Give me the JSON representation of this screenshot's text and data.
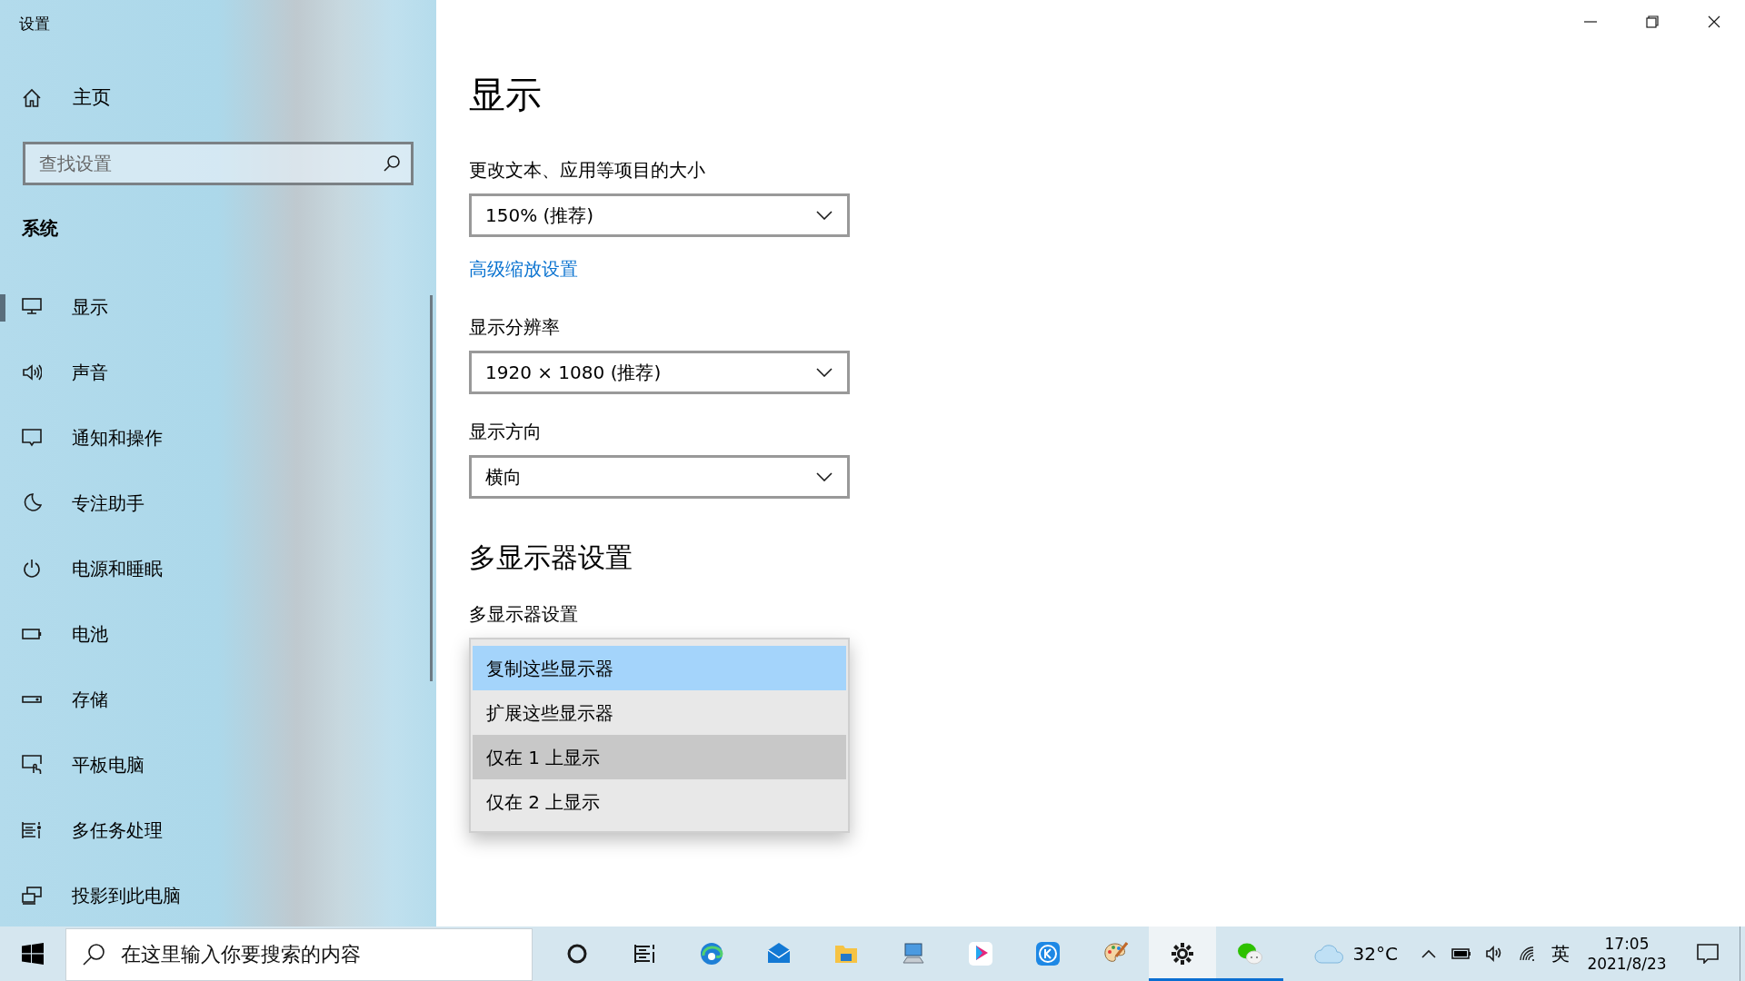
{
  "window": {
    "title": "设置"
  },
  "sidebar": {
    "home": "主页",
    "search": {
      "placeholder": "查找设置"
    },
    "section": "系统",
    "items": [
      {
        "label": "显示",
        "selected": true
      },
      {
        "label": "声音",
        "selected": false
      },
      {
        "label": "通知和操作",
        "selected": false
      },
      {
        "label": "专注助手",
        "selected": false
      },
      {
        "label": "电源和睡眠",
        "selected": false
      },
      {
        "label": "电池",
        "selected": false
      },
      {
        "label": "存储",
        "selected": false
      },
      {
        "label": "平板电脑",
        "selected": false
      },
      {
        "label": "多任务处理",
        "selected": false
      },
      {
        "label": "投影到此电脑",
        "selected": false
      }
    ]
  },
  "content": {
    "title": "显示",
    "scale": {
      "label": "更改文本、应用等项目的大小",
      "value": "150% (推荐)"
    },
    "advanced_link": "高级缩放设置",
    "resolution": {
      "label": "显示分辨率",
      "value": "1920 × 1080 (推荐)"
    },
    "orientation": {
      "label": "显示方向",
      "value": "横向"
    },
    "multi_heading": "多显示器设置",
    "multi": {
      "label": "多显示器设置",
      "expanded": true,
      "options": [
        {
          "label": "复制这些显示器",
          "selected": true,
          "hovered": false
        },
        {
          "label": "扩展这些显示器",
          "selected": false,
          "hovered": false
        },
        {
          "label": "仅在 1 上显示",
          "selected": false,
          "hovered": true
        },
        {
          "label": "仅在 2 上显示",
          "selected": false,
          "hovered": false
        }
      ]
    }
  },
  "taskbar": {
    "search": {
      "placeholder": "在这里输入你要搜索的内容"
    },
    "apps": [
      {
        "running": false,
        "active": false
      },
      {
        "running": false,
        "active": false
      },
      {
        "running": false,
        "active": false
      },
      {
        "running": false,
        "active": false
      },
      {
        "running": false,
        "active": false
      },
      {
        "running": false,
        "active": false
      },
      {
        "running": false,
        "active": false
      },
      {
        "running": false,
        "active": false
      },
      {
        "running": false,
        "active": false
      },
      {
        "running": true,
        "active": true
      },
      {
        "running": true,
        "active": false
      }
    ],
    "weather": "32°C",
    "ime": "英",
    "time": "17:05",
    "date": "2021/8/23"
  }
}
